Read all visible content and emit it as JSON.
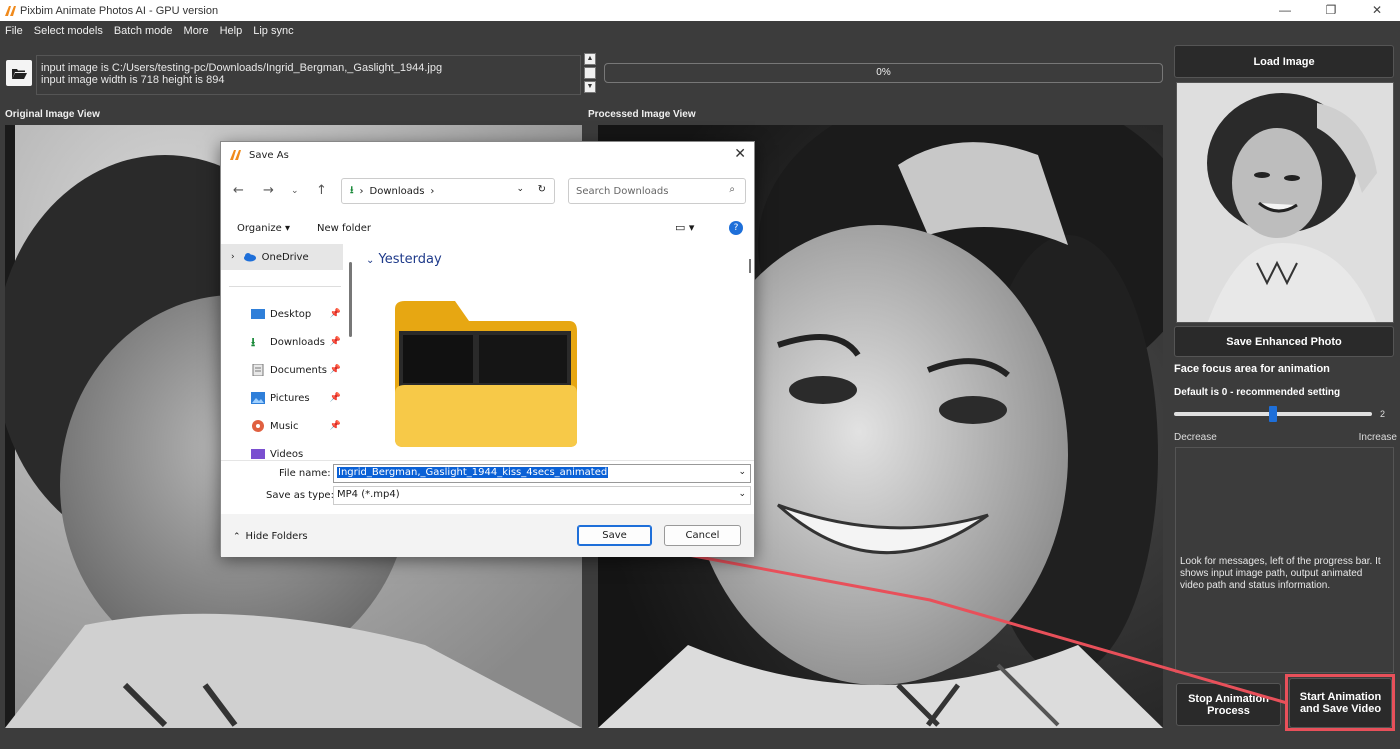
{
  "window": {
    "title": "Pixbim Animate Photos AI - GPU version",
    "minimize": "—",
    "maximize": "❐",
    "close": "✕"
  },
  "menu": [
    "File",
    "Select models",
    "Batch mode",
    "More",
    "Help",
    "Lip sync"
  ],
  "messages": {
    "line1": "input image is C:/Users/testing-pc/Downloads/Ingrid_Bergman,_Gaslight_1944.jpg",
    "line2": "input image width is 718 height is 894"
  },
  "progress": {
    "value": 0,
    "label": "0%"
  },
  "views": {
    "original_label": "Original Image View",
    "processed_label": "Processed Image View"
  },
  "right_panel": {
    "load_button": "Load Image",
    "save_enhanced_button": "Save Enhanced Photo",
    "face_focus_title": "Face focus area for animation",
    "face_focus_default": "Default is 0 - recommended setting",
    "slider_value": "2",
    "slider_fraction": 0.5,
    "decrease_label": "Decrease",
    "increase_label": "Increase",
    "info_text": "Look for messages, left of the progress bar. It shows input image path, output animated video path and status information.",
    "stop_button": "Stop Animation Process",
    "start_button": "Start Animation and Save Video"
  },
  "dialog": {
    "title": "Save As",
    "address": "Downloads",
    "search_placeholder": "Search Downloads",
    "organize": "Organize",
    "new_folder": "New folder",
    "nav_items": [
      {
        "label": "OneDrive",
        "icon": "cloud-icon"
      },
      {
        "label": "Desktop",
        "icon": "desktop-icon"
      },
      {
        "label": "Downloads",
        "icon": "download-icon"
      },
      {
        "label": "Documents",
        "icon": "documents-icon"
      },
      {
        "label": "Pictures",
        "icon": "pictures-icon"
      },
      {
        "label": "Music",
        "icon": "music-icon"
      },
      {
        "label": "Videos",
        "icon": "videos-icon"
      }
    ],
    "group_name": "Yesterday",
    "file_name_label": "File name:",
    "file_name_value": "Ingrid_Bergman,_Gaslight_1944_kiss_4secs_animated",
    "save_as_type_label": "Save as type:",
    "save_as_type_value": "MP4 (*.mp4)",
    "hide_folders": "Hide Folders",
    "save_button": "Save",
    "cancel_button": "Cancel"
  },
  "colors": {
    "background": "#3c3c3c",
    "accent_red": "#e8505a",
    "slider_knob": "#1e6fd9",
    "selection": "#0b61d6"
  }
}
